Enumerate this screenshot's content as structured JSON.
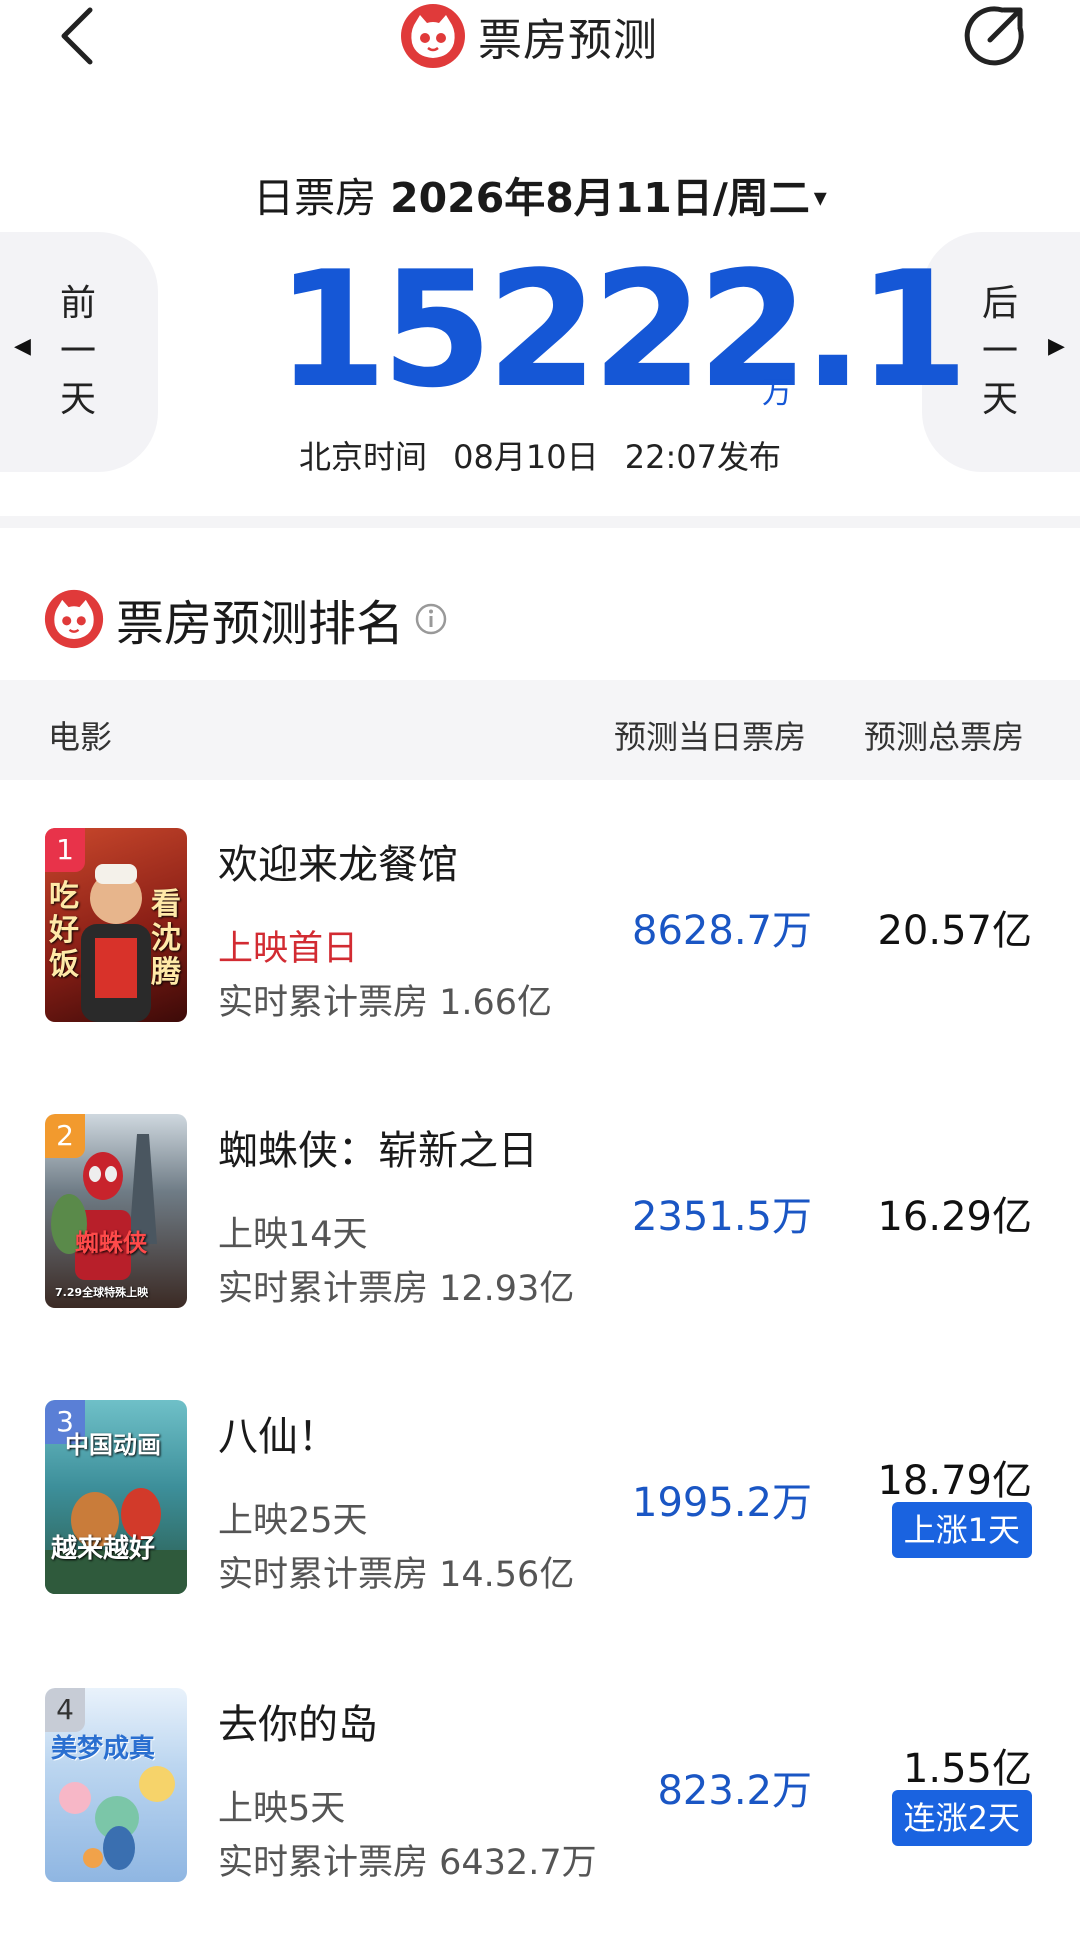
{
  "header": {
    "title": "票房预测"
  },
  "summary": {
    "date_kind": "日票房",
    "date": "2026年8月11日/周二",
    "caret": "▾",
    "prev_label": "前一天",
    "next_label": "后一天",
    "total": "15222.1",
    "total_unit": "万",
    "publish_tz": "北京时间",
    "publish_date": "08月10日",
    "publish_time": "22:07发布"
  },
  "ranking": {
    "title": "票房预测排名",
    "columns": {
      "movie": "电影",
      "today": "预测当日票房",
      "total": "预测总票房"
    },
    "movies": [
      {
        "rank": "1",
        "name": "欢迎来龙餐馆",
        "status": "上映首日",
        "cumulative": "实时累计票房 1.66亿",
        "today": "8628.7万",
        "total": "20.57亿",
        "badge": "",
        "rank_color": "#e8334a",
        "poster_text_left": "吃好饭",
        "poster_text_right": "看沈腾"
      },
      {
        "rank": "2",
        "name": "蜘蛛侠：崭新之日",
        "status": "上映14天",
        "cumulative": "实时累计票房 12.93亿",
        "today": "2351.5万",
        "total": "16.29亿",
        "badge": "",
        "rank_color": "#f29a2e",
        "poster_text_left": "蜘蛛侠",
        "poster_text_right": "7.29全球特殊上映"
      },
      {
        "rank": "3",
        "name": "八仙！",
        "status": "上映25天",
        "cumulative": "实时累计票房 14.56亿",
        "today": "1995.2万",
        "total": "18.79亿",
        "badge": "上涨1天",
        "rank_color": "#5a7fd6",
        "poster_text_left": "中国动画",
        "poster_text_right": "越来越好"
      },
      {
        "rank": "4",
        "name": "去你的岛",
        "status": "上映5天",
        "cumulative": "实时累计票房 6432.7万",
        "today": "823.2万",
        "total": "1.55亿",
        "badge": "连涨2天",
        "rank_color": "#9aa0ad",
        "poster_text_left": "美梦成真",
        "poster_text_right": ""
      }
    ]
  },
  "colors": {
    "accent_blue": "#1557d6",
    "brand_red": "#e03a3a",
    "badge_blue": "#1a63e0",
    "status_red": "#d22b32"
  }
}
